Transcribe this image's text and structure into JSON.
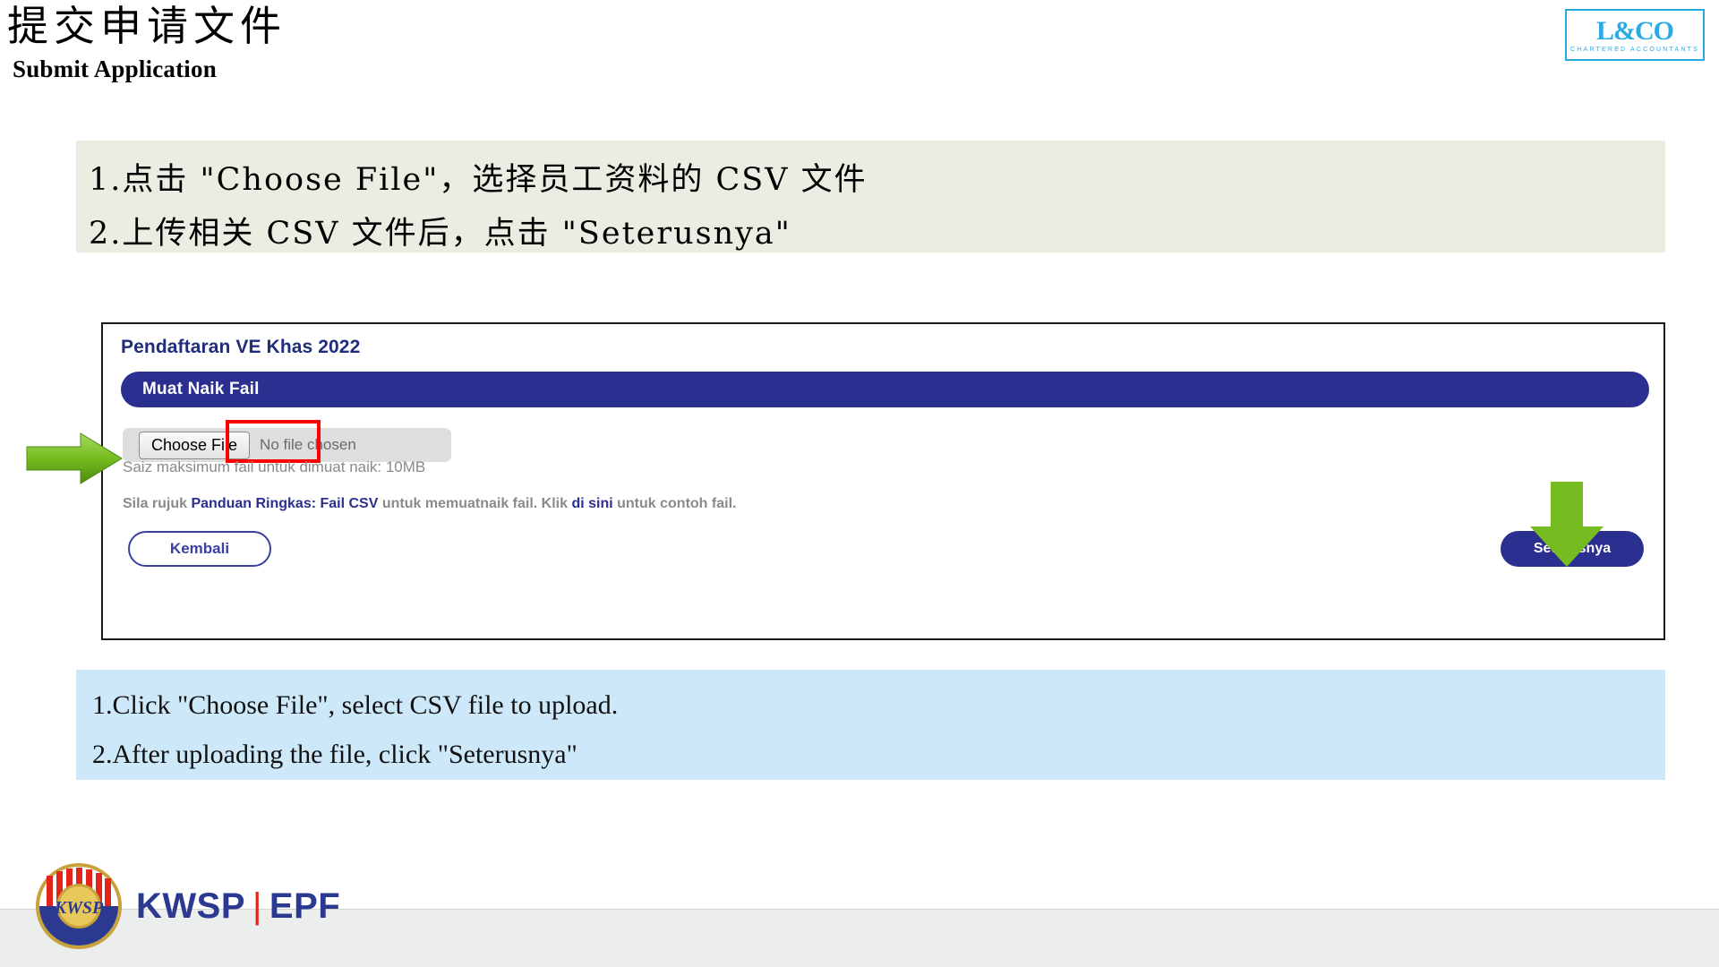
{
  "header": {
    "title_zh": "提交申请文件",
    "title_en": "Submit Application",
    "logo": {
      "mark": "L&CO",
      "sub": "CHARTERED ACCOUNTANTS"
    }
  },
  "instructions_zh": {
    "line1": "1.点击 \"Choose File\"，选择员工资料的 CSV 文件",
    "line2": "2.上传相关 CSV 文件后，点击 \"Seterusnya\""
  },
  "screenshot": {
    "page_title": "Pendaftaran VE Khas 2022",
    "banner_label": "Muat Naik Fail",
    "choose_file_button": "Choose File",
    "no_file_chosen": "No file chosen",
    "max_size_hint": "Saiz maksimum fail untuk dimuat naik: 10MB",
    "guide_hint": {
      "pre": "Sila rujuk ",
      "link1": "Panduan Ringkas: Fail CSV",
      "mid": " untuk memuatnaik fail. Klik ",
      "link2": "di sini",
      "post": " untuk contoh fail."
    },
    "back_button": "Kembali",
    "next_button": "Seterusnya"
  },
  "instructions_en": {
    "line1": "1.Click \"Choose File\", select CSV file to upload.",
    "line2": "2.After uploading the file, click \"Seterusnya\""
  },
  "footer": {
    "brand_primary": "KWSP",
    "brand_separator": "|",
    "brand_secondary": "EPF"
  },
  "colors": {
    "kwsp_blue": "#2B2F8F",
    "accent_green": "#76BC21",
    "highlight_red": "#FF0000",
    "beige_box": "#ECEDE2",
    "blue_box": "#CCE8F9",
    "lco_cyan": "#29ABE2"
  }
}
